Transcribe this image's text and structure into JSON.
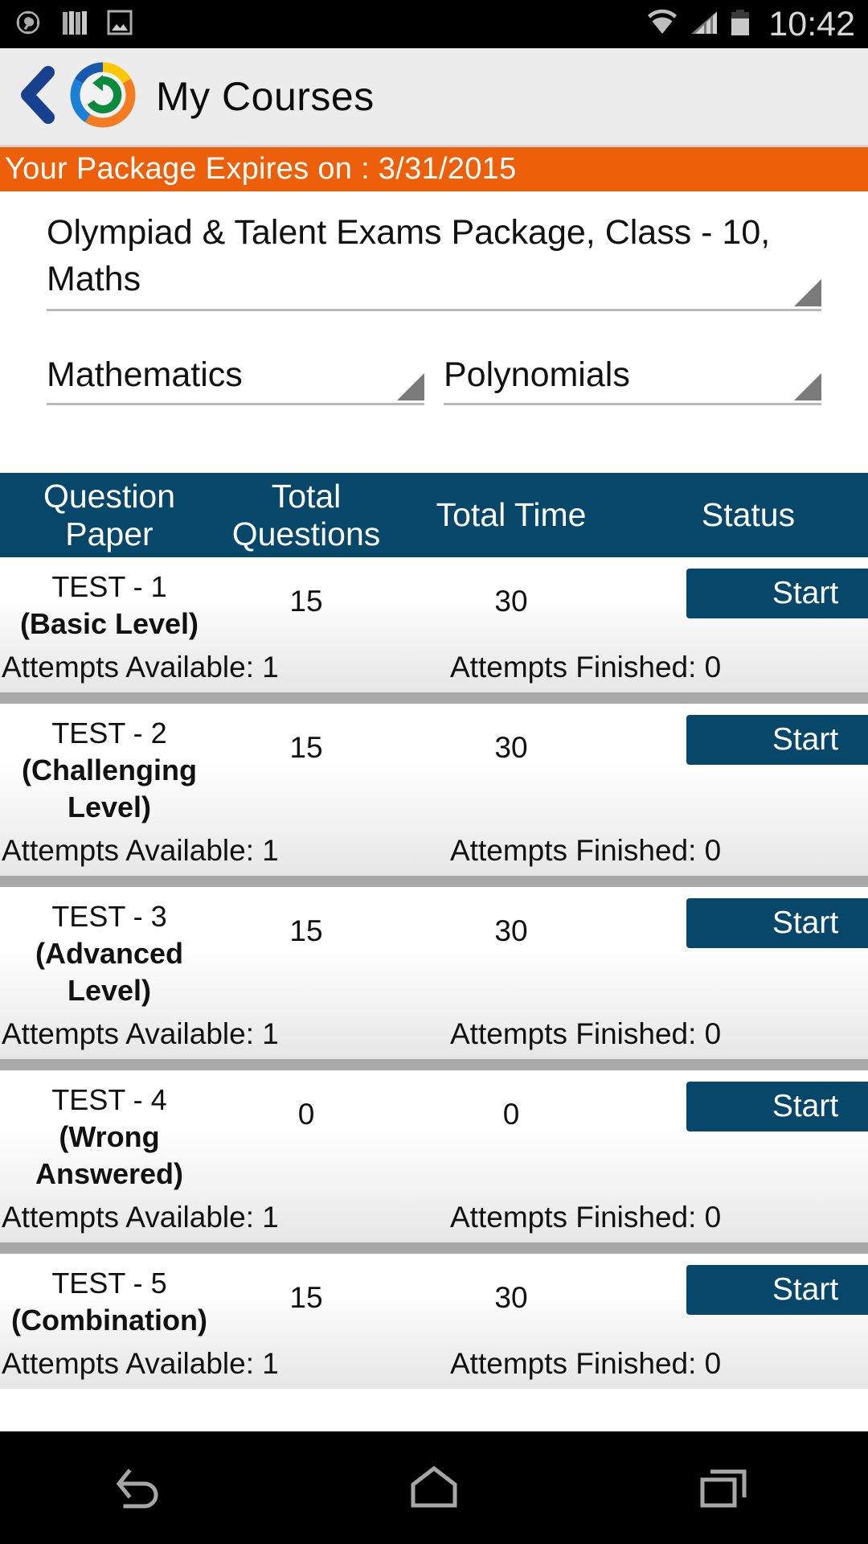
{
  "status_bar": {
    "time": "10:42",
    "icons": [
      "compass-wrench-icon",
      "books-icon",
      "gallery-icon",
      "wifi-icon",
      "cellular-signal-icon",
      "battery-icon"
    ]
  },
  "action_bar": {
    "back_label": "back-chevron-icon",
    "logo_label": "app-logo-icon",
    "title": "My Courses"
  },
  "expiry_banner": {
    "text": "Your Package Expires on : 3/31/2015",
    "background_color": "#ee5f09",
    "text_color": "#ffffff"
  },
  "spinners": {
    "package": {
      "value": "Olympiad & Talent Exams Package, Class - 10, Maths"
    },
    "subject": {
      "value": "Mathematics"
    },
    "chapter": {
      "value": "Polynomials"
    }
  },
  "table": {
    "header_color": "#07486a",
    "columns": [
      {
        "line1": "Question",
        "line2": "Paper"
      },
      {
        "line1": "Total",
        "line2": "Questions"
      },
      {
        "line1": "Total Time",
        "line2": ""
      },
      {
        "line1": "Status",
        "line2": ""
      }
    ],
    "rows": [
      {
        "name": "TEST - 1",
        "level": "(Basic Level)",
        "total_questions": "15",
        "total_time": "30",
        "action_label": "Start",
        "attempts_available": "Attempts Available: 1",
        "attempts_finished": "Attempts Finished: 0"
      },
      {
        "name": "TEST - 2",
        "level": "(Challenging Level)",
        "total_questions": "15",
        "total_time": "30",
        "action_label": "Start",
        "attempts_available": "Attempts Available: 1",
        "attempts_finished": "Attempts Finished: 0"
      },
      {
        "name": "TEST - 3",
        "level": "(Advanced Level)",
        "total_questions": "15",
        "total_time": "30",
        "action_label": "Start",
        "attempts_available": "Attempts Available: 1",
        "attempts_finished": "Attempts Finished: 0"
      },
      {
        "name": "TEST - 4",
        "level": "(Wrong Answered)",
        "total_questions": "0",
        "total_time": "0",
        "action_label": "Start",
        "attempts_available": "Attempts Available: 1",
        "attempts_finished": "Attempts Finished: 0"
      },
      {
        "name": "TEST - 5",
        "level": "(Combination)",
        "total_questions": "15",
        "total_time": "30",
        "action_label": "Start",
        "attempts_available": "Attempts Available: 1",
        "attempts_finished": "Attempts Finished: 0"
      }
    ]
  },
  "nav_bar": {
    "buttons": [
      "back-nav-icon",
      "home-nav-icon",
      "recents-nav-icon"
    ]
  }
}
